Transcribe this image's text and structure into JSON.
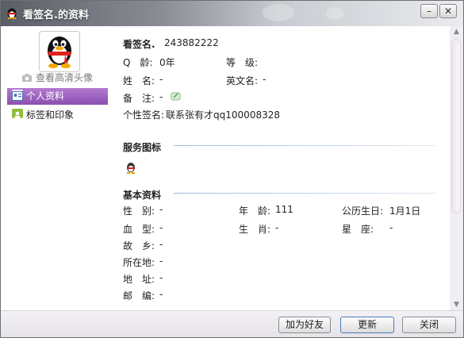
{
  "window": {
    "title": "看签名.的资料"
  },
  "sidebar": {
    "hd_link": "查看高清头像",
    "items": [
      {
        "label": "个人资料",
        "active": true
      },
      {
        "label": "标签和印象",
        "active": false
      }
    ]
  },
  "profile": {
    "nickname": "看签名.",
    "qq_number": "243882222",
    "fields": {
      "q_age_label": "Q　龄:",
      "q_age_value": "0年",
      "level_label": "等　级:",
      "name_label": "姓　名:",
      "name_value": "-",
      "english_name_label": "英文名:",
      "english_name_value": "-",
      "remark_label": "备　注:",
      "remark_value": "-",
      "signature_label": "个性签名:",
      "signature_value": "联系张有才qq100008328"
    }
  },
  "service_section": {
    "title": "服务图标"
  },
  "basic_section": {
    "title": "基本资料",
    "rows": [
      {
        "l1": "性　别:",
        "v1": "-",
        "l2": "年　龄:",
        "v2": "111",
        "l3": "公历生日:",
        "v3": "1月1日"
      },
      {
        "l1": "血　型:",
        "v1": "-",
        "l2": "生　肖:",
        "v2": "-",
        "l3": "星　座:",
        "v3": "-"
      },
      {
        "l1": "故　乡:",
        "v1": "-"
      },
      {
        "l1": "所在地:",
        "v1": "-"
      },
      {
        "l1": "地　址:",
        "v1": "-"
      },
      {
        "l1": "邮　编:",
        "v1": "-"
      }
    ]
  },
  "footer": {
    "add_friend": "加为好友",
    "update": "更新",
    "close": "关闭"
  },
  "colors": {
    "accent": "#9b5fc0",
    "title_bar": "#7f828a"
  }
}
